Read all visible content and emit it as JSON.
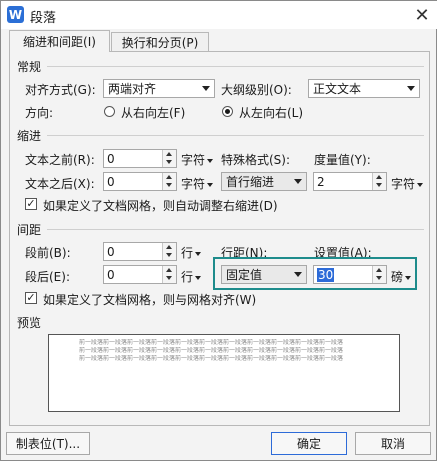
{
  "window": {
    "title": "段落",
    "app_icon": "W"
  },
  "tabs": [
    {
      "label": "缩进和间距(I)",
      "active": true
    },
    {
      "label": "换行和分页(P)",
      "active": false
    }
  ],
  "general": {
    "section": "常规",
    "align_label": "对齐方式(G):",
    "align_value": "两端对齐",
    "outline_label": "大纲级别(O):",
    "outline_value": "正文文本",
    "direction_label": "方向:",
    "rtl_label": "从右向左(F)",
    "ltr_label": "从左向右(L)",
    "selected_direction": "ltr"
  },
  "indent": {
    "section": "缩进",
    "before_label": "文本之前(R):",
    "before_value": "0",
    "before_unit": "字符",
    "after_label": "文本之后(X):",
    "after_value": "0",
    "after_unit": "字符",
    "special_label": "特殊格式(S):",
    "special_value": "首行缩进",
    "measure_label": "度量值(Y):",
    "measure_value": "2",
    "measure_unit": "字符",
    "auto_adjust_label": "如果定义了文档网格，则自动调整右缩进(D)",
    "auto_adjust_checked": true
  },
  "spacing": {
    "section": "间距",
    "before_label": "段前(B):",
    "before_value": "0",
    "before_unit": "行",
    "after_label": "段后(E):",
    "after_value": "0",
    "after_unit": "行",
    "line_label": "行距(N):",
    "line_value": "固定值",
    "setting_label": "设置值(A):",
    "setting_value": "30",
    "setting_unit": "磅",
    "grid_label": "如果定义了文档网格，则与网格对齐(W)",
    "grid_checked": true
  },
  "preview": {
    "section": "预览",
    "sample_text": "前一段落前一段落前一段落前一段落前一段落前一段落前一段落前一段落前一段落前一段落前一段落"
  },
  "buttons": {
    "tabs": "制表位(T)...",
    "ok": "确定",
    "cancel": "取消"
  },
  "colors": {
    "highlight_border": "#1e8c8c",
    "selection": "#2d6bd8",
    "app_icon": "#2b6fd6"
  }
}
